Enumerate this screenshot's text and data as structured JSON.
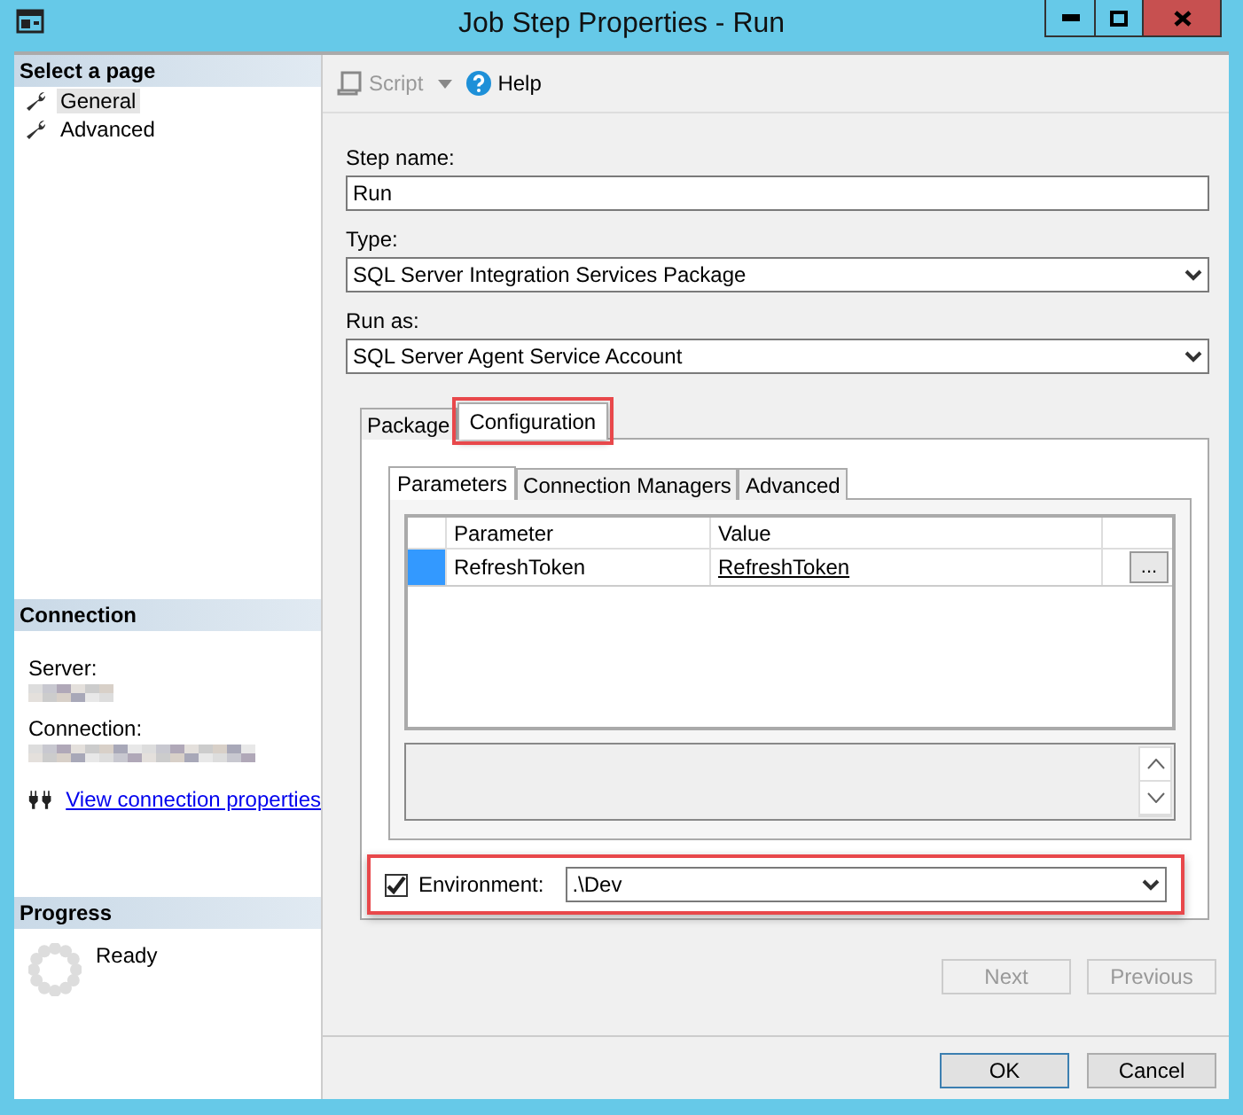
{
  "window": {
    "title": "Job Step Properties - Run"
  },
  "sidebar": {
    "header": "Select a page",
    "items": [
      {
        "label": "General",
        "selected": true
      },
      {
        "label": "Advanced",
        "selected": false
      }
    ]
  },
  "connection": {
    "header": "Connection",
    "server_label": "Server:",
    "connection_label": "Connection:",
    "link": "View connection properties"
  },
  "progress": {
    "header": "Progress",
    "status": "Ready"
  },
  "toolbar": {
    "script": {
      "label": "Script",
      "disabled": true
    },
    "help": "Help"
  },
  "fields": [
    {
      "kind": "text",
      "label": "Step name:",
      "value": "Run"
    },
    {
      "kind": "select",
      "label": "Type:",
      "value": "SQL Server Integration Services Package"
    },
    {
      "kind": "select",
      "label": "Run as:",
      "value": "SQL Server Agent Service Account"
    }
  ],
  "tabs": [
    {
      "label": "Package",
      "selected": false,
      "highlight": false
    },
    {
      "label": "Configuration",
      "selected": true,
      "highlight": true
    }
  ],
  "subtabs": [
    {
      "label": "Parameters",
      "selected": true
    },
    {
      "label": "Connection Managers",
      "selected": false
    },
    {
      "label": "Advanced",
      "selected": false
    }
  ],
  "grid": {
    "columns": [
      "Parameter",
      "Value"
    ],
    "rows": [
      {
        "parameter": "RefreshToken",
        "value": "RefreshToken",
        "selected": true,
        "ellipsis": "..."
      }
    ]
  },
  "environment": {
    "label": "Environment:",
    "checked": true,
    "value": ".\\Dev",
    "highlight": true
  },
  "nav_buttons": [
    {
      "label": "Next",
      "disabled": true
    },
    {
      "label": "Previous",
      "disabled": true
    }
  ],
  "buttons": [
    {
      "label": "OK",
      "default": true
    },
    {
      "label": "Cancel",
      "default": false
    }
  ]
}
